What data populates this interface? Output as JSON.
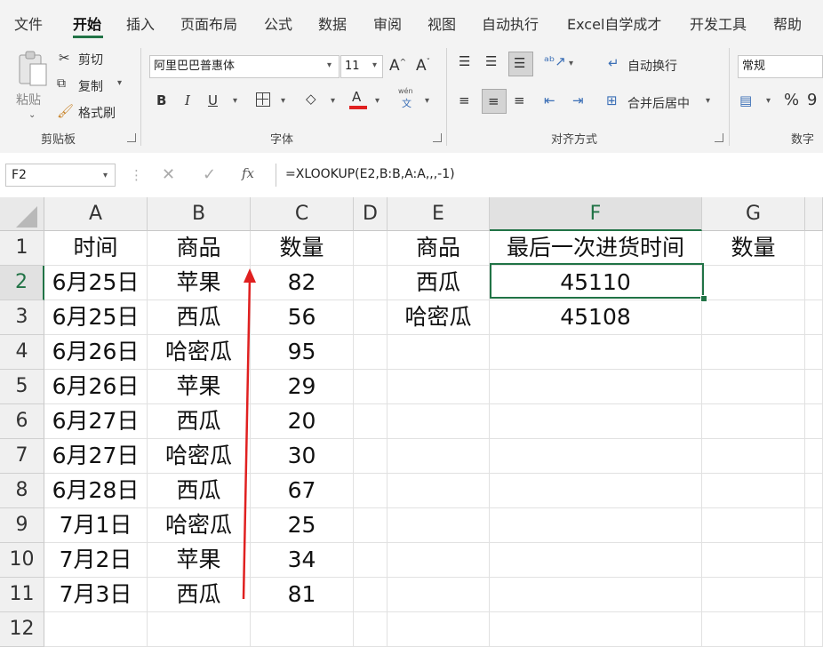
{
  "menu": {
    "items": [
      "文件",
      "开始",
      "插入",
      "页面布局",
      "公式",
      "数据",
      "审阅",
      "视图",
      "自动执行",
      "Excel自学成才",
      "开发工具",
      "帮助"
    ],
    "active_index": 1
  },
  "ribbon": {
    "clipboard": {
      "paste": "粘贴",
      "cut": "剪切",
      "copy": "复制",
      "format_painter": "格式刷",
      "label": "剪贴板"
    },
    "font": {
      "family": "阿里巴巴普惠体",
      "size": "11",
      "label": "字体",
      "bold": "B",
      "italic": "I",
      "underline": "U",
      "phonetic": "wén",
      "phonetic_char": "文"
    },
    "alignment": {
      "wrap_text": "自动换行",
      "merge_center": "合并后居中",
      "label": "对齐方式"
    },
    "number": {
      "format": "常规",
      "label": "数字"
    }
  },
  "formula_bar": {
    "name_box": "F2",
    "fx": "fx",
    "formula": "=XLOOKUP(E2,B:B,A:A,,,-1)"
  },
  "sheet": {
    "columns": [
      "A",
      "B",
      "C",
      "D",
      "E",
      "F",
      "G"
    ],
    "selected_column": "F",
    "selected_row": "2",
    "rows": [
      {
        "num": "1",
        "cells": [
          "时间",
          "商品",
          "数量",
          "",
          "商品",
          "最后一次进货时间",
          "数量"
        ]
      },
      {
        "num": "2",
        "cells": [
          "6月25日",
          "苹果",
          "82",
          "",
          "西瓜",
          "45110",
          ""
        ]
      },
      {
        "num": "3",
        "cells": [
          "6月25日",
          "西瓜",
          "56",
          "",
          "哈密瓜",
          "45108",
          ""
        ]
      },
      {
        "num": "4",
        "cells": [
          "6月26日",
          "哈密瓜",
          "95",
          "",
          "",
          "",
          ""
        ]
      },
      {
        "num": "5",
        "cells": [
          "6月26日",
          "苹果",
          "29",
          "",
          "",
          "",
          ""
        ]
      },
      {
        "num": "6",
        "cells": [
          "6月27日",
          "西瓜",
          "20",
          "",
          "",
          "",
          ""
        ]
      },
      {
        "num": "7",
        "cells": [
          "6月27日",
          "哈密瓜",
          "30",
          "",
          "",
          "",
          ""
        ]
      },
      {
        "num": "8",
        "cells": [
          "6月28日",
          "西瓜",
          "67",
          "",
          "",
          "",
          ""
        ]
      },
      {
        "num": "9",
        "cells": [
          "7月1日",
          "哈密瓜",
          "25",
          "",
          "",
          "",
          ""
        ]
      },
      {
        "num": "10",
        "cells": [
          "7月2日",
          "苹果",
          "34",
          "",
          "",
          "",
          ""
        ]
      },
      {
        "num": "11",
        "cells": [
          "7月3日",
          "西瓜",
          "81",
          "",
          "",
          "",
          ""
        ]
      },
      {
        "num": "12",
        "cells": [
          "",
          "",
          "",
          "",
          "",
          "",
          ""
        ]
      }
    ]
  },
  "colors": {
    "accent": "#217346",
    "arrow": "#e02020",
    "font_color_bar": "#e02020"
  }
}
